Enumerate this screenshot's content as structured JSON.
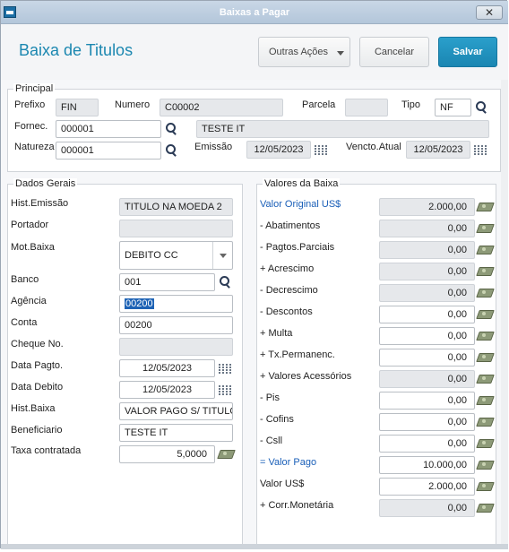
{
  "window": {
    "title": "Baixas a Pagar",
    "close_label": "✕"
  },
  "header": {
    "title": "Baixa de Titulos",
    "outras_acoes": "Outras Ações",
    "cancelar": "Cancelar",
    "salvar": "Salvar"
  },
  "principal": {
    "title": "Principal",
    "prefixo_label": "Prefixo",
    "prefixo": "FIN",
    "numero_label": "Numero",
    "numero": "C00002",
    "parcela_label": "Parcela",
    "parcela": "",
    "tipo_label": "Tipo",
    "tipo": "NF",
    "fornec_label": "Fornec.",
    "fornec": "000001",
    "fornec_nome": "TESTE IT",
    "natureza_label": "Natureza",
    "natureza": "000001",
    "emissao_label": "Emissão",
    "emissao": "12/05/2023",
    "vencto_label": "Vencto.Atual",
    "vencto": "12/05/2023"
  },
  "dados_gerais": {
    "title": "Dados Gerais",
    "hist_emissao_label": "Hist.Emissão",
    "hist_emissao": "TITULO NA MOEDA 2",
    "portador_label": "Portador",
    "portador": "",
    "mot_baixa_label": "Mot.Baixa",
    "mot_baixa": "DEBITO CC",
    "banco_label": "Banco",
    "banco": "001",
    "agencia_label": "Agência",
    "agencia": "00200",
    "conta_label": "Conta",
    "conta": "00200",
    "cheque_label": "Cheque No.",
    "cheque": "",
    "data_pagto_label": "Data Pagto.",
    "data_pagto": "12/05/2023",
    "data_debito_label": "Data Debito",
    "data_debito": "12/05/2023",
    "hist_baixa_label": "Hist.Baixa",
    "hist_baixa": "VALOR PAGO S/ TITULO",
    "beneficiario_label": "Beneficiario",
    "beneficiario": "TESTE IT",
    "taxa_label": "Taxa contratada",
    "taxa": "5,0000"
  },
  "valores": {
    "title": "Valores da Baixa",
    "rows": [
      {
        "label": "Valor Original US$",
        "value": "2.000,00",
        "readonly": true,
        "blue": true
      },
      {
        "label": "- Abatimentos",
        "value": "0,00",
        "readonly": true,
        "blue": false
      },
      {
        "label": "- Pagtos.Parciais",
        "value": "0,00",
        "readonly": true,
        "blue": false
      },
      {
        "label": "+ Acrescimo",
        "value": "0,00",
        "readonly": true,
        "blue": false
      },
      {
        "label": "- Decrescimo",
        "value": "0,00",
        "readonly": true,
        "blue": false
      },
      {
        "label": "- Descontos",
        "value": "0,00",
        "readonly": false,
        "blue": false
      },
      {
        "label": "+ Multa",
        "value": "0,00",
        "readonly": false,
        "blue": false
      },
      {
        "label": "+ Tx.Permanenc.",
        "value": "0,00",
        "readonly": false,
        "blue": false
      },
      {
        "label": "+ Valores Acessórios",
        "value": "0,00",
        "readonly": true,
        "blue": false
      },
      {
        "label": "- Pis",
        "value": "0,00",
        "readonly": false,
        "blue": false
      },
      {
        "label": "- Cofins",
        "value": "0,00",
        "readonly": false,
        "blue": false
      },
      {
        "label": "- Csll",
        "value": "0,00",
        "readonly": false,
        "blue": false
      },
      {
        "label": "= Valor Pago",
        "value": "10.000,00",
        "readonly": false,
        "blue": true
      },
      {
        "label": "Valor US$",
        "value": "2.000,00",
        "readonly": false,
        "blue": false
      },
      {
        "label": "+ Corr.Monetária",
        "value": "0,00",
        "readonly": true,
        "blue": false
      }
    ]
  }
}
